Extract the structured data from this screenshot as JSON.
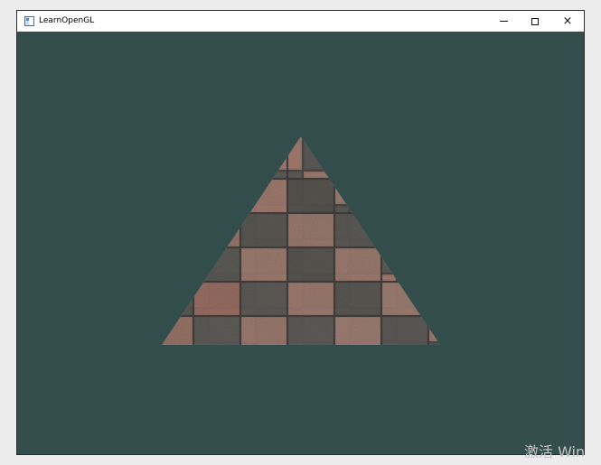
{
  "window": {
    "title": "LearnOpenGL",
    "controls": {
      "minimize": "−",
      "maximize": "□",
      "close": "×"
    }
  },
  "viewport": {
    "background": "#334d4d"
  },
  "watermark": {
    "text": "激活 Win"
  }
}
